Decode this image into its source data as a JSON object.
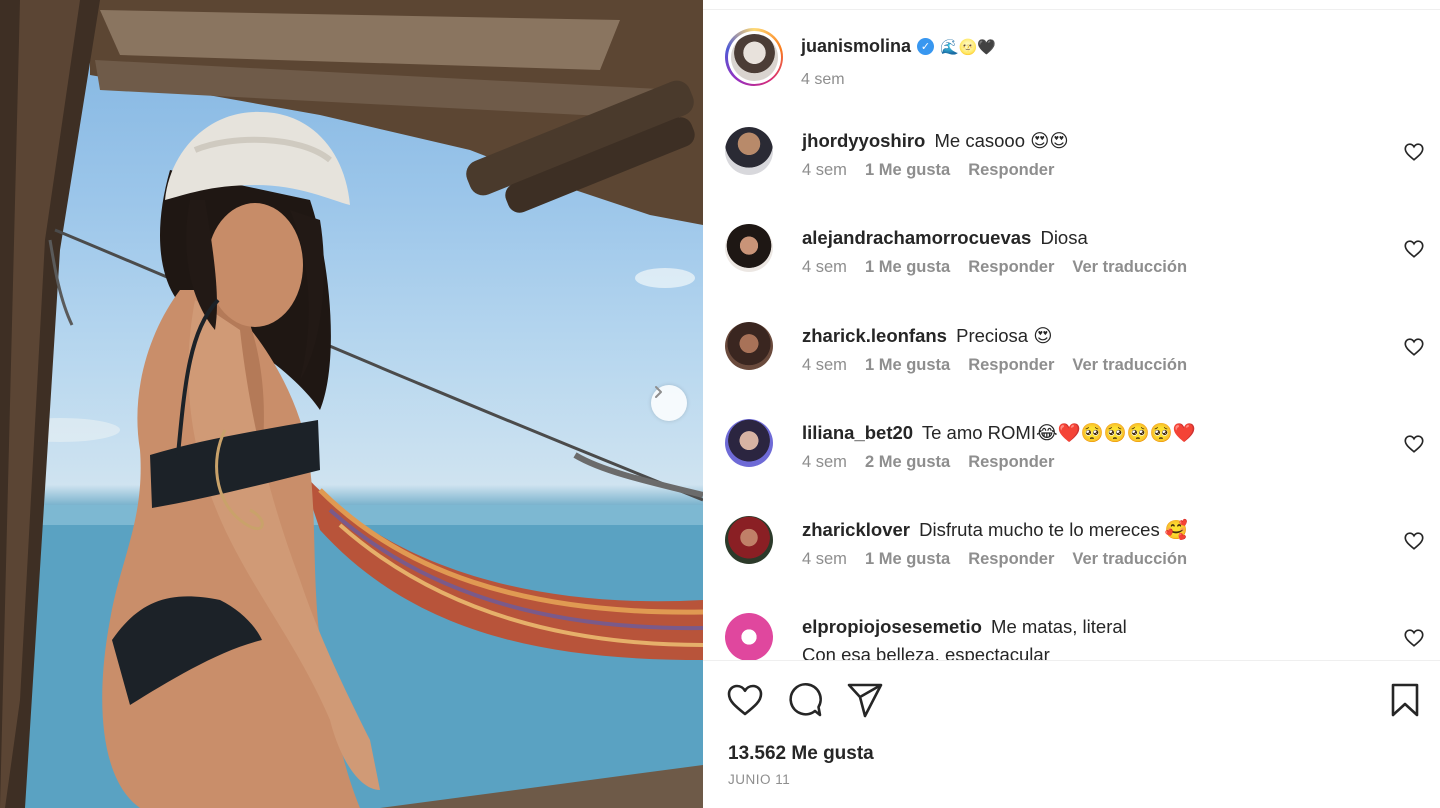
{
  "post": {
    "owner": {
      "username": "juanismolina",
      "verified_mark": "✓",
      "bio_emojis": "🌊🌝🖤",
      "time": "4 sem"
    },
    "photo": {
      "description_icon": "photo-carousel",
      "next_icon": "chevron-right-icon"
    },
    "comments": [
      {
        "username": "jhordyyoshiro",
        "text": "Me casooo 😍😍",
        "time": "4 sem",
        "likes": "1 Me gusta",
        "reply": "Responder",
        "translate": ""
      },
      {
        "username": "alejandrachamorrocuevas",
        "text": "Diosa",
        "time": "4 sem",
        "likes": "1 Me gusta",
        "reply": "Responder",
        "translate": "Ver traducción"
      },
      {
        "username": "zharick.leonfans",
        "text": "Preciosa 😍",
        "time": "4 sem",
        "likes": "1 Me gusta",
        "reply": "Responder",
        "translate": "Ver traducción"
      },
      {
        "username": "liliana_bet20",
        "text": "Te amo ROMI😂❤️🥺🥺🥺🥺❤️",
        "time": "4 sem",
        "likes": "2 Me gusta",
        "reply": "Responder",
        "translate": ""
      },
      {
        "username": "zharicklover",
        "text": "Disfruta mucho te lo mereces 🥰",
        "time": "4 sem",
        "likes": "1 Me gusta",
        "reply": "Responder",
        "translate": "Ver traducción"
      },
      {
        "username": "elpropiojosesemetio",
        "text": "Me matas, literal",
        "text2": "Con esa belleza, espectacular"
      }
    ],
    "likes_count": "13.562 Me gusta",
    "date": "JUNIO 11"
  },
  "colors": {
    "text": "#262626",
    "secondary": "#8e8e8e",
    "verified": "#3897f0",
    "divider": "#efefef"
  }
}
